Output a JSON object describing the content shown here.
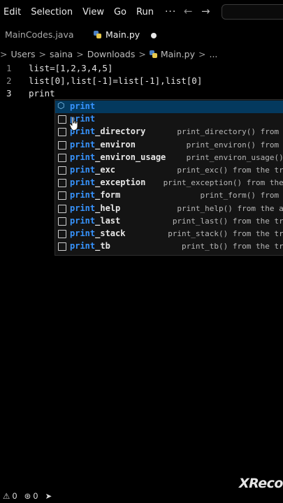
{
  "menubar": {
    "items": [
      "Edit",
      "Selection",
      "View",
      "Go",
      "Run"
    ],
    "more": "···"
  },
  "tabs": [
    {
      "label": "MainCodes.java"
    },
    {
      "label": "Main.py"
    }
  ],
  "breadcrumb": {
    "items": [
      "Users",
      "saina",
      "Downloads",
      "Main.py"
    ],
    "ellipsis": "..."
  },
  "editor": {
    "lines": [
      {
        "num": "1",
        "code": "list=[1,2,3,4,5]"
      },
      {
        "num": "2",
        "code": "list[0],list[-1]=list[-1],list[0]"
      },
      {
        "num": "3",
        "code": "print"
      }
    ]
  },
  "suggestions": {
    "match": "print",
    "items": [
      {
        "rest": "",
        "detail": ""
      },
      {
        "rest": "",
        "detail": ""
      },
      {
        "rest": "_directory",
        "detail": "print_directory() from th"
      },
      {
        "rest": "_environ",
        "detail": "print_environ() from th"
      },
      {
        "rest": "_environ_usage",
        "detail": "print_environ_usage() f"
      },
      {
        "rest": "_exc",
        "detail": "print_exc() from the trac"
      },
      {
        "rest": "_exception",
        "detail": "print_exception() from the t"
      },
      {
        "rest": "_form",
        "detail": "print_form() from th"
      },
      {
        "rest": "_help",
        "detail": "print_help() from the arg"
      },
      {
        "rest": "_last",
        "detail": "print_last() from the trac"
      },
      {
        "rest": "_stack",
        "detail": "print_stack() from the trac"
      },
      {
        "rest": "_tb",
        "detail": "print_tb() from the trac"
      }
    ]
  },
  "statusbar": {
    "errors": "0",
    "ports": "0"
  },
  "watermark": "XReco",
  "colors": {
    "selection": "#04395e",
    "match": "#3794ff",
    "background": "#000000"
  }
}
